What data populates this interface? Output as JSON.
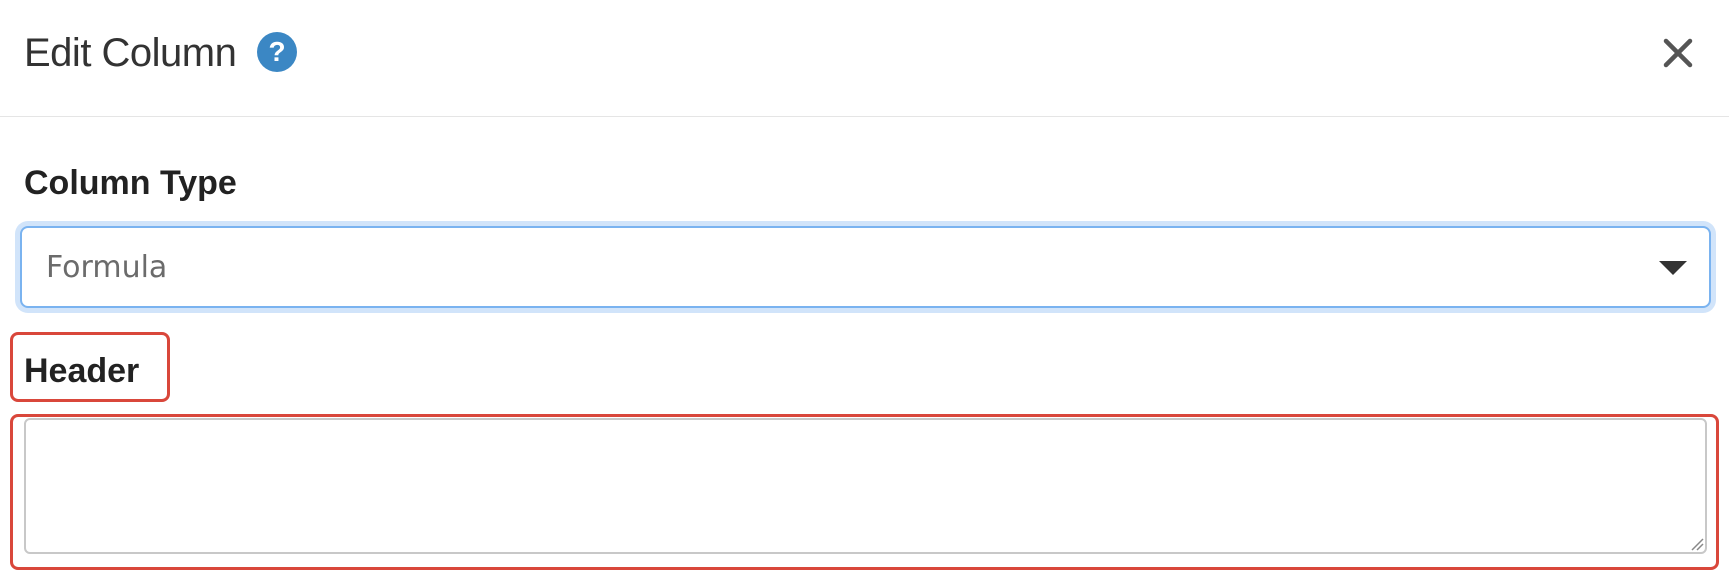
{
  "dialog": {
    "title": "Edit Column",
    "help_icon": "question-circle-icon",
    "help_glyph": "?",
    "close_icon": "close-icon"
  },
  "form": {
    "column_type": {
      "label": "Column Type",
      "selected_value": "Formula",
      "dropdown_icon": "caret-down-icon"
    },
    "header": {
      "label": "Header",
      "value": "",
      "placeholder": ""
    }
  },
  "colors": {
    "help_icon_bg": "#3b87c4",
    "focus_border": "#7ab3f0",
    "highlight_border": "#d9473b"
  }
}
